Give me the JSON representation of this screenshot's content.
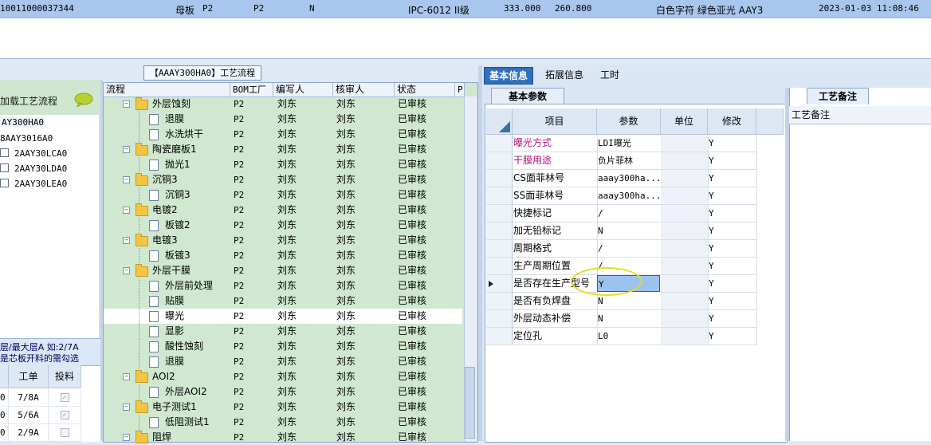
{
  "top_row": {
    "id": "10011000037344",
    "type": "母板",
    "p2a": "P2",
    "p2b": "P2",
    "flag": "N",
    "grade": "IPC-6012 II级",
    "v1": "333.000",
    "v2": "260.800",
    "colors": "白色字符  绿色亚光  AAY3",
    "datetime": "2023-01-03 11:08:46"
  },
  "left": {
    "load_label": "加载工艺流程",
    "tree": [
      "AY300HA0",
      "8AAY3016A0",
      "2AAY30LCA0",
      "2AAY30LDA0",
      "2AAY30LEA0"
    ],
    "note_line1": "层/最大层A 如:2/7A",
    "note_line2": "是芯板开料的需勾选",
    "grid_headers": [
      "工单",
      "投料"
    ],
    "grid_rows": [
      {
        "c0": "0",
        "work": "7/8A"
      },
      {
        "c0": "0",
        "work": "5/6A"
      },
      {
        "c0": "0",
        "work": "2/9A"
      }
    ]
  },
  "flow": {
    "tab_label": "【AAAY300HA0】工艺流程",
    "headers": [
      "流程",
      "BOM工厂",
      "编写人",
      "核审人",
      "状态",
      "P"
    ],
    "rows": [
      {
        "name": "外层蚀刻",
        "bom": "P2",
        "writer": "刘东",
        "reviewer": "刘东",
        "status": "已审核"
      },
      {
        "name": "退膜",
        "bom": "P2",
        "writer": "刘东",
        "reviewer": "刘东",
        "status": "已审核"
      },
      {
        "name": "水洗烘干",
        "bom": "P2",
        "writer": "刘东",
        "reviewer": "刘东",
        "status": "已审核"
      },
      {
        "name": "陶瓷磨板1",
        "bom": "P2",
        "writer": "刘东",
        "reviewer": "刘东",
        "status": "已审核"
      },
      {
        "name": "抛光1",
        "bom": "P2",
        "writer": "刘东",
        "reviewer": "刘东",
        "status": "已审核"
      },
      {
        "name": "沉铜3",
        "bom": "P2",
        "writer": "刘东",
        "reviewer": "刘东",
        "status": "已审核"
      },
      {
        "name": "沉铜3",
        "bom": "P2",
        "writer": "刘东",
        "reviewer": "刘东",
        "status": "已审核"
      },
      {
        "name": "电镀2",
        "bom": "P2",
        "writer": "刘东",
        "reviewer": "刘东",
        "status": "已审核"
      },
      {
        "name": "板镀2",
        "bom": "P2",
        "writer": "刘东",
        "reviewer": "刘东",
        "status": "已审核"
      },
      {
        "name": "电镀3",
        "bom": "P2",
        "writer": "刘东",
        "reviewer": "刘东",
        "status": "已审核"
      },
      {
        "name": "板镀3",
        "bom": "P2",
        "writer": "刘东",
        "reviewer": "刘东",
        "status": "已审核"
      },
      {
        "name": "外层干膜",
        "bom": "P2",
        "writer": "刘东",
        "reviewer": "刘东",
        "status": "已审核"
      },
      {
        "name": "外层前处理",
        "bom": "P2",
        "writer": "刘东",
        "reviewer": "刘东",
        "status": "已审核"
      },
      {
        "name": "贴膜",
        "bom": "P2",
        "writer": "刘东",
        "reviewer": "刘东",
        "status": "已审核"
      },
      {
        "name": "曝光",
        "bom": "P2",
        "writer": "刘东",
        "reviewer": "刘东",
        "status": "已审核"
      },
      {
        "name": "显影",
        "bom": "P2",
        "writer": "刘东",
        "reviewer": "刘东",
        "status": "已审核"
      },
      {
        "name": "酸性蚀刻",
        "bom": "P2",
        "writer": "刘东",
        "reviewer": "刘东",
        "status": "已审核"
      },
      {
        "name": "退膜",
        "bom": "P2",
        "writer": "刘东",
        "reviewer": "刘东",
        "status": "已审核"
      },
      {
        "name": "AOI2",
        "bom": "P2",
        "writer": "刘东",
        "reviewer": "刘东",
        "status": "已审核"
      },
      {
        "name": "外层AOI2",
        "bom": "P2",
        "writer": "刘东",
        "reviewer": "刘东",
        "status": "已审核"
      },
      {
        "name": "电子测试1",
        "bom": "P2",
        "writer": "刘东",
        "reviewer": "刘东",
        "status": "已审核"
      },
      {
        "name": "低阻测试1",
        "bom": "P2",
        "writer": "刘东",
        "reviewer": "刘东",
        "status": "已审核"
      },
      {
        "name": "阻焊",
        "bom": "P2",
        "writer": "刘东",
        "reviewer": "刘东",
        "status": "已审核"
      }
    ]
  },
  "info": {
    "tabs": [
      "基本信息",
      "拓展信息",
      "工时"
    ],
    "sub_tab": "基本参数",
    "headers": [
      "项目",
      "参数",
      "单位",
      "修改"
    ],
    "rows": [
      {
        "item": "曝光方式",
        "param": "LDI曝光",
        "unit": "",
        "mod": "Y",
        "color": "#b0127a"
      },
      {
        "item": "干膜用途",
        "param": "负片菲林",
        "unit": "",
        "mod": "Y",
        "color": "#b0127a"
      },
      {
        "item": "CS面菲林号",
        "param": "aaay300ha...",
        "unit": "",
        "mod": "Y",
        "color": "#000000"
      },
      {
        "item": "SS面菲林号",
        "param": "aaay300ha...",
        "unit": "",
        "mod": "Y",
        "color": "#000000"
      },
      {
        "item": "快捷标记",
        "param": "/",
        "unit": "",
        "mod": "Y",
        "color": "#000000"
      },
      {
        "item": "加无铅标记",
        "param": "N",
        "unit": "",
        "mod": "Y",
        "color": "#000000"
      },
      {
        "item": "周期格式",
        "param": "/",
        "unit": "",
        "mod": "Y",
        "color": "#000000"
      },
      {
        "item": "生产周期位置",
        "param": "/",
        "unit": "",
        "mod": "Y",
        "color": "#000000"
      },
      {
        "item": "是否存在生产型号",
        "param": "Y",
        "unit": "",
        "mod": "Y",
        "color": "#000000"
      },
      {
        "item": "是否有负焊盘",
        "param": "N",
        "unit": "",
        "mod": "Y",
        "color": "#000000"
      },
      {
        "item": "外层动态补偿",
        "param": "N",
        "unit": "",
        "mod": "Y",
        "color": "#000000"
      },
      {
        "item": "定位孔",
        "param": "L0",
        "unit": "",
        "mod": "Y",
        "color": "#000000"
      }
    ]
  },
  "notes": {
    "tab": "工艺备注",
    "header": "工艺备注"
  }
}
